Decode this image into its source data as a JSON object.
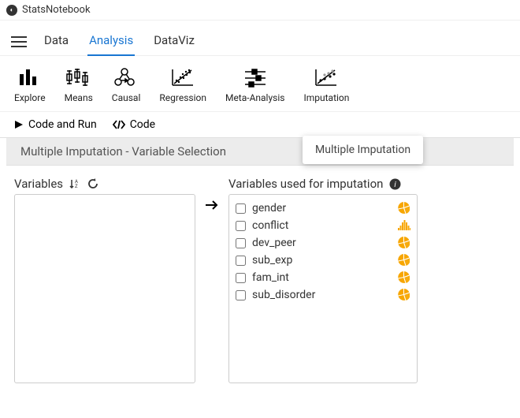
{
  "app": {
    "title": "StatsNotebook"
  },
  "menu": {
    "tabs": [
      "Data",
      "Analysis",
      "DataViz"
    ],
    "active_index": 1
  },
  "toolbar": {
    "items": [
      {
        "label": "Explore"
      },
      {
        "label": "Means"
      },
      {
        "label": "Causal"
      },
      {
        "label": "Regression"
      },
      {
        "label": "Meta-Analysis"
      },
      {
        "label": "Imputation"
      }
    ]
  },
  "codebar": {
    "run_label": "Code and Run",
    "code_label": "Code"
  },
  "tooltip": {
    "text": "Multiple Imputation"
  },
  "panel": {
    "title": "Multiple Imputation - Variable Selection",
    "left_header": "Variables",
    "right_header": "Variables used for imputation",
    "variables": [
      {
        "name": "gender",
        "type": "categorical"
      },
      {
        "name": "conflict",
        "type": "continuous"
      },
      {
        "name": "dev_peer",
        "type": "categorical"
      },
      {
        "name": "sub_exp",
        "type": "categorical"
      },
      {
        "name": "fam_int",
        "type": "categorical"
      },
      {
        "name": "sub_disorder",
        "type": "categorical"
      }
    ]
  }
}
